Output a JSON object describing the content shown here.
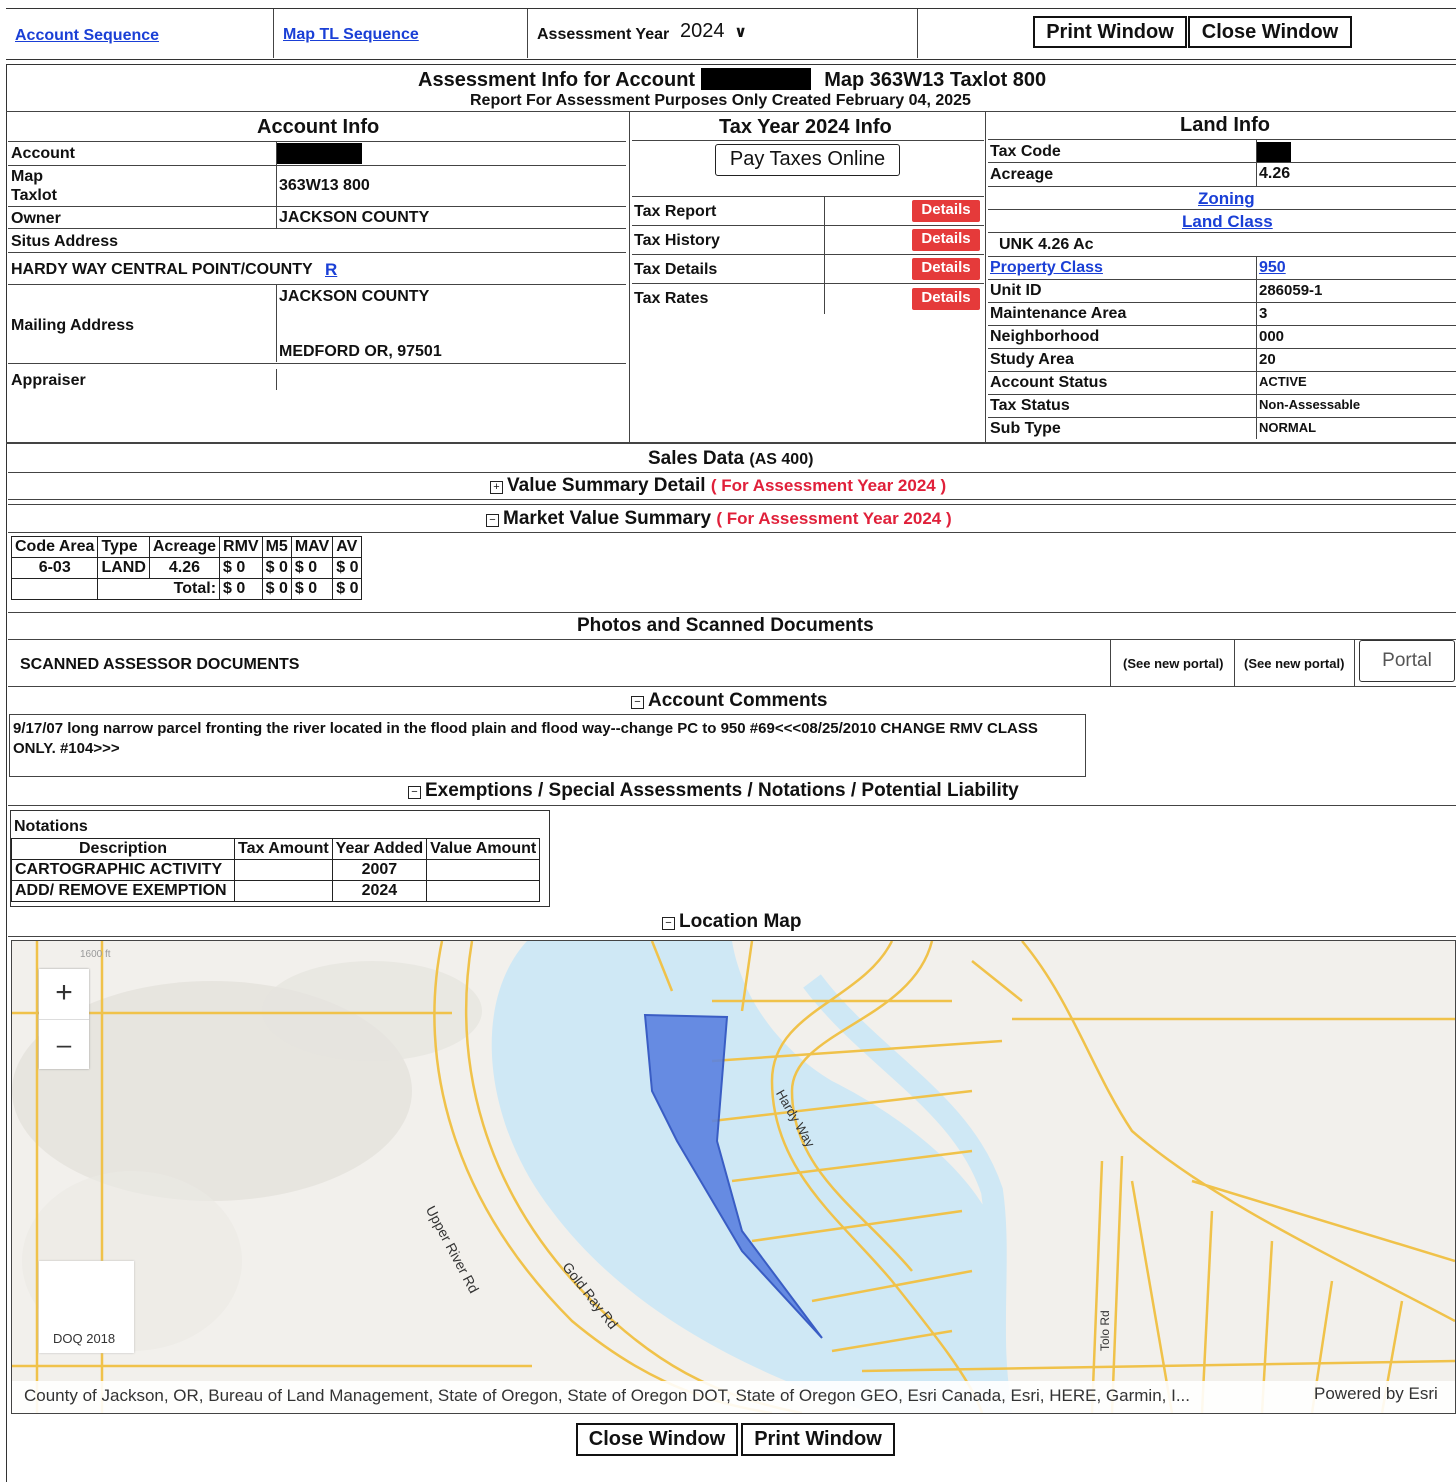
{
  "top_nav": {
    "account_sequence": "Account Sequence",
    "map_tl_sequence": "Map TL Sequence",
    "assessment_year_label": "Assessment Year",
    "assessment_year_value": "2024",
    "print_window": "Print Window",
    "close_window": "Close Window"
  },
  "header": {
    "title_prefix": "Assessment Info for Account",
    "title_suffix": "Map 363W13  Taxlot 800",
    "subtitle": "Report For Assessment Purposes Only Created February 04, 2025"
  },
  "account_info": {
    "heading": "Account Info",
    "account_label": "Account",
    "map_label": "Map",
    "taxlot_label": "Taxlot",
    "map_taxlot_value": "363W13 800",
    "owner_label": "Owner",
    "owner_value": "JACKSON COUNTY",
    "situs_label": "Situs Address",
    "situs_value": "HARDY WAY CENTRAL POINT/COUNTY",
    "situs_link": "R",
    "mailing_label": "Mailing Address",
    "mailing_line1": "JACKSON COUNTY",
    "mailing_line2": "MEDFORD OR, 97501",
    "appraiser_label": "Appraiser"
  },
  "tax_info": {
    "heading": "Tax Year 2024 Info",
    "pay_button": "Pay Taxes Online",
    "details_label": "Details",
    "rows": [
      "Tax Report",
      "Tax History",
      "Tax Details",
      "Tax Rates"
    ]
  },
  "land_info": {
    "heading": "Land Info",
    "tax_code_label": "Tax Code",
    "acreage_label": "Acreage",
    "acreage_value": "4.26",
    "zoning_link": "Zoning",
    "land_class_link": "Land Class",
    "unk_text": "UNK 4.26 Ac",
    "property_class_label": "Property Class",
    "property_class_value": "950",
    "unit_id_label": "Unit ID",
    "unit_id_value": "286059-1",
    "maintenance_label": "Maintenance Area",
    "maintenance_value": "3",
    "neighborhood_label": "Neighborhood",
    "neighborhood_value": "000",
    "study_area_label": "Study Area",
    "study_area_value": "20",
    "account_status_label": "Account Status",
    "account_status_value": "ACTIVE",
    "tax_status_label": "Tax Status",
    "tax_status_value": "Non-Assessable",
    "sub_type_label": "Sub Type",
    "sub_type_value": "NORMAL"
  },
  "sales": {
    "title": "Sales Data",
    "suffix": "(AS 400)"
  },
  "value_summary": {
    "title": "Value Summary Detail",
    "note": "( For Assessment Year 2024 )"
  },
  "market_summary": {
    "title": "Market Value Summary",
    "note": "( For Assessment Year 2024 )",
    "headers": [
      "Code Area",
      "Type",
      "Acreage",
      "RMV",
      "M5",
      "MAV",
      "AV"
    ],
    "row": [
      "6-03",
      "LAND",
      "4.26",
      "$ 0",
      "$ 0",
      "$ 0",
      "$ 0"
    ],
    "total_label": "Total:",
    "totals": [
      "$ 0",
      "$ 0",
      "$ 0",
      "$ 0"
    ]
  },
  "photos": {
    "title": "Photos and Scanned Documents",
    "scanned_label": "SCANNED ASSESSOR DOCUMENTS",
    "see_portal_1": "(See new portal)",
    "see_portal_2": "(See new portal)",
    "portal_button": "Portal"
  },
  "comments": {
    "title": "Account Comments",
    "text": "9/17/07 long narrow parcel fronting the river located in the flood plain and flood way--change PC to 950 #69<<<08/25/2010 CHANGE RMV CLASS ONLY. #104>>>"
  },
  "exemptions": {
    "title": "Exemptions / Special Assessments / Notations / Potential Liability",
    "notations_label": "Notations",
    "headers": [
      "Description",
      "Tax Amount",
      "Year Added",
      "Value Amount"
    ],
    "rows": [
      [
        "CARTOGRAPHIC ACTIVITY",
        "",
        "2007",
        ""
      ],
      [
        "ADD/ REMOVE EXEMPTION",
        "",
        "2024",
        ""
      ]
    ]
  },
  "location_map": {
    "title": "Location Map",
    "zoom_in": "+",
    "zoom_out": "–",
    "road_labels": [
      "Upper River Rd",
      "Gold Ray Rd",
      "Hardy Way",
      "Tolo Rd"
    ],
    "corner_label": "1600 ft",
    "doq_label": "DOQ 2018",
    "attribution": "County of Jackson, OR, Bureau of Land Management, State of Oregon, State of Oregon DOT, State of Oregon GEO, Esri Canada, Esri, HERE, Garmin, I...",
    "powered_by": "Powered by Esri"
  },
  "bottom": {
    "close_window": "Close Window",
    "print_window": "Print Window"
  }
}
